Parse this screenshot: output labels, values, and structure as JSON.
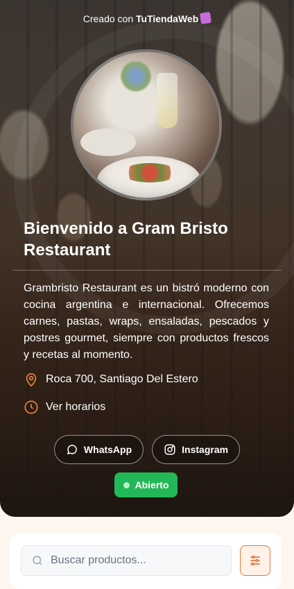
{
  "credit": {
    "prefix": "Creado con ",
    "brand": "TuTiendaWeb",
    "icon": "tutiendaweb-logo-icon"
  },
  "store": {
    "welcome": "Bienvenido a ",
    "name": "Gram Bristo Restaurant",
    "description": "Grambristo Restaurant es un bistró moderno con cocina argentina e internacional. Ofrecemos carnes, pastas, wraps, ensaladas, pescados y postres gourmet, siempre con productos frescos y recetas al momento.",
    "address": "Roca 700, Santiago Del Estero",
    "hours_label": "Ver horarios"
  },
  "social": {
    "whatsapp_label": "WhatsApp",
    "instagram_label": "Instagram"
  },
  "status": {
    "label": "Abierto",
    "color": "#22b857"
  },
  "search": {
    "placeholder": "Buscar productos..."
  },
  "colors": {
    "accent": "#e07a3c",
    "open": "#22b857"
  }
}
